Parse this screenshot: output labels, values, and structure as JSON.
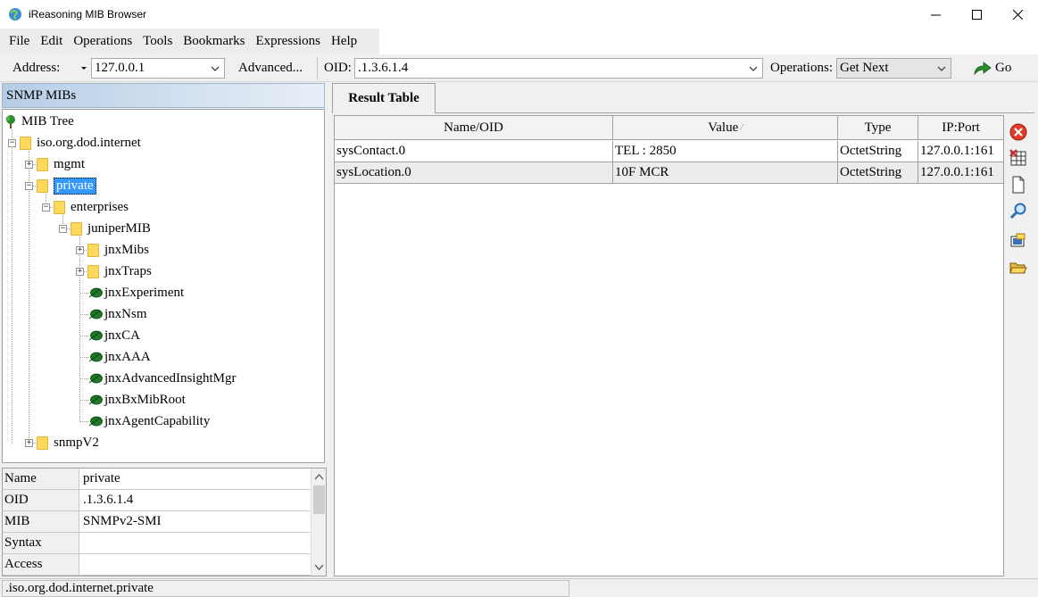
{
  "window": {
    "title": "iReasoning MIB Browser",
    "minimize_glyph": "—",
    "maximize_glyph": "☐",
    "close_glyph": "✕"
  },
  "menu": [
    "File",
    "Edit",
    "Operations",
    "Tools",
    "Bookmarks",
    "Expressions",
    "Help"
  ],
  "toolbar": {
    "address_label": "Address:",
    "address_value": "127.0.0.1",
    "advanced_label": "Advanced...",
    "oid_label": "OID:",
    "oid_value": ".1.3.6.1.4",
    "operations_label": "Operations:",
    "operations_value": "Get Next",
    "go_label": "Go"
  },
  "left_panel": {
    "header": "SNMP MIBs",
    "tree": {
      "root": "MIB Tree",
      "nodes": {
        "iso": "iso.org.dod.internet",
        "mgmt": "mgmt",
        "private": "private",
        "enterprises": "enterprises",
        "juniperMIB": "juniperMIB",
        "jnxMibs": "jnxMibs",
        "jnxTraps": "jnxTraps",
        "jnxExperiment": "jnxExperiment",
        "jnxNsm": "jnxNsm",
        "jnxCA": "jnxCA",
        "jnxAAA": "jnxAAA",
        "jnxAdvancedInsightMgr": "jnxAdvancedInsightMgr",
        "jnxBxMibRoot": "jnxBxMibRoot",
        "jnxAgentCapability": "jnxAgentCapability",
        "snmpV2": "snmpV2"
      }
    },
    "properties": [
      {
        "key": "Name",
        "value": "private"
      },
      {
        "key": "OID",
        "value": ".1.3.6.1.4"
      },
      {
        "key": "MIB",
        "value": "SNMPv2-SMI"
      },
      {
        "key": "Syntax",
        "value": ""
      },
      {
        "key": "Access",
        "value": ""
      }
    ]
  },
  "result": {
    "tab_label": "Result Table",
    "columns": [
      "Name/OID",
      "Value",
      "Type",
      "IP:Port"
    ],
    "sort_indicator": "⁄",
    "rows": [
      [
        "sysContact.0",
        "TEL : 2850",
        "OctetString",
        "127.0.0.1:161"
      ],
      [
        "sysLocation.0",
        "10F MCR",
        "OctetString",
        "127.0.0.1:161"
      ]
    ]
  },
  "side_buttons": [
    "delete-icon",
    "table-delete-icon",
    "new-document-icon",
    "find-icon",
    "export-icon",
    "open-folder-icon"
  ],
  "status": {
    "text": ".iso.org.dod.internet.private"
  },
  "colors": {
    "selection": "#3399ff",
    "header_gradient_start": "#b6cde6",
    "folder": "#ffd95e",
    "leaf": "#1e7a2a",
    "go_arrow": "#2a8f2a",
    "delete": "#e03a2a"
  }
}
